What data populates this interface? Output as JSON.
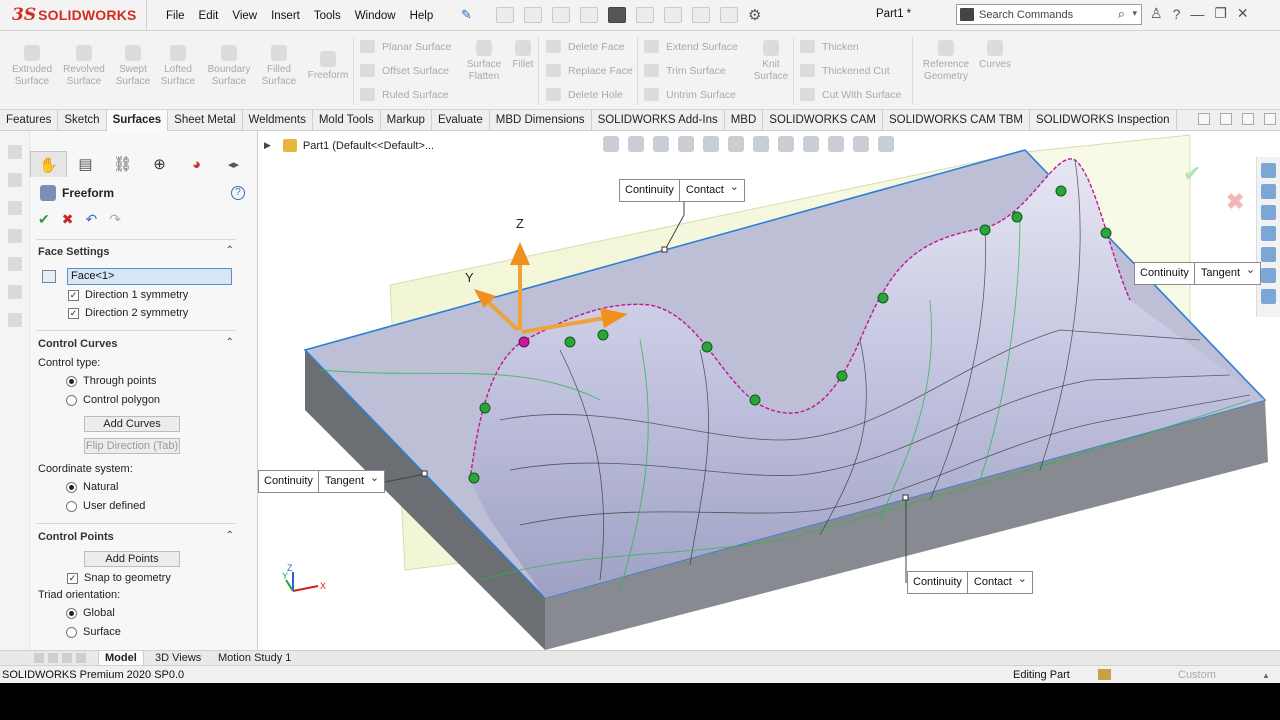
{
  "app": {
    "logo_mark": "3S",
    "logo_name": "SOLIDWORKS",
    "doc_name": "Part1 *"
  },
  "menu": [
    "File",
    "Edit",
    "View",
    "Insert",
    "Tools",
    "Window",
    "Help"
  ],
  "search": {
    "placeholder": "Search Commands"
  },
  "ribbon": {
    "large": [
      {
        "label": "Extruded Surface"
      },
      {
        "label": "Revolved Surface"
      },
      {
        "label": "Swept Surface"
      },
      {
        "label": "Lofted Surface"
      },
      {
        "label": "Boundary Surface"
      },
      {
        "label": "Filled Surface"
      },
      {
        "label": "Freeform"
      },
      {
        "label": "Surface Flatten"
      },
      {
        "label": "Fillet"
      },
      {
        "label": "Knit Surface"
      },
      {
        "label": "Reference Geometry"
      },
      {
        "label": "Curves"
      }
    ],
    "col1": [
      "Planar Surface",
      "Offset Surface",
      "Ruled Surface"
    ],
    "col2": [
      "Delete Face",
      "Replace Face",
      "Delete Hole"
    ],
    "col3": [
      "Extend Surface",
      "Trim Surface",
      "Untrim Surface"
    ],
    "col4": [
      "Thicken",
      "Thickened Cut",
      "Cut With Surface"
    ]
  },
  "tabs": [
    "Features",
    "Sketch",
    "Surfaces",
    "Sheet Metal",
    "Weldments",
    "Mold Tools",
    "Markup",
    "Evaluate",
    "MBD Dimensions",
    "SOLIDWORKS Add-Ins",
    "MBD",
    "SOLIDWORKS CAM",
    "SOLIDWORKS CAM TBM",
    "SOLIDWORKS Inspection"
  ],
  "active_tab": "Surfaces",
  "pm": {
    "title": "Freeform",
    "help": "?",
    "face_settings": {
      "title": "Face Settings",
      "face_value": "Face<1>",
      "dir1": "Direction 1 symmetry",
      "dir2": "Direction 2 symmetry"
    },
    "control_curves": {
      "title": "Control Curves",
      "type_label": "Control type:",
      "opt_through": "Through points",
      "opt_polygon": "Control polygon",
      "add_curves": "Add Curves",
      "flip": "Flip Direction (Tab)",
      "coord_label": "Coordinate system:",
      "opt_natural": "Natural",
      "opt_user": "User defined"
    },
    "control_points": {
      "title": "Control Points",
      "add_points": "Add Points",
      "snap": "Snap to geometry",
      "triad_label": "Triad orientation:",
      "opt_global": "Global",
      "opt_surface": "Surface"
    }
  },
  "viewport": {
    "breadcrumb": "Part1  (Default<<Default>...",
    "continuity_label": "Continuity",
    "tag_top": "Contact",
    "tag_right": "Tangent",
    "tag_left": "Tangent",
    "tag_bottom": "Contact",
    "axis_z": "Z",
    "axis_y": "Y",
    "mini_x": "X",
    "mini_y": "Y",
    "mini_z": "Z"
  },
  "bottom_tabs": [
    "Model",
    "3D Views",
    "Motion Study 1"
  ],
  "status": {
    "left": "SOLIDWORKS Premium 2020 SP0.0",
    "mode": "Editing Part",
    "units": "Custom"
  },
  "colors": {
    "brand": "#d52b1e",
    "accent": "#1a73c8",
    "surface": "#c8c9e2",
    "plane": "#f0f3cb"
  }
}
